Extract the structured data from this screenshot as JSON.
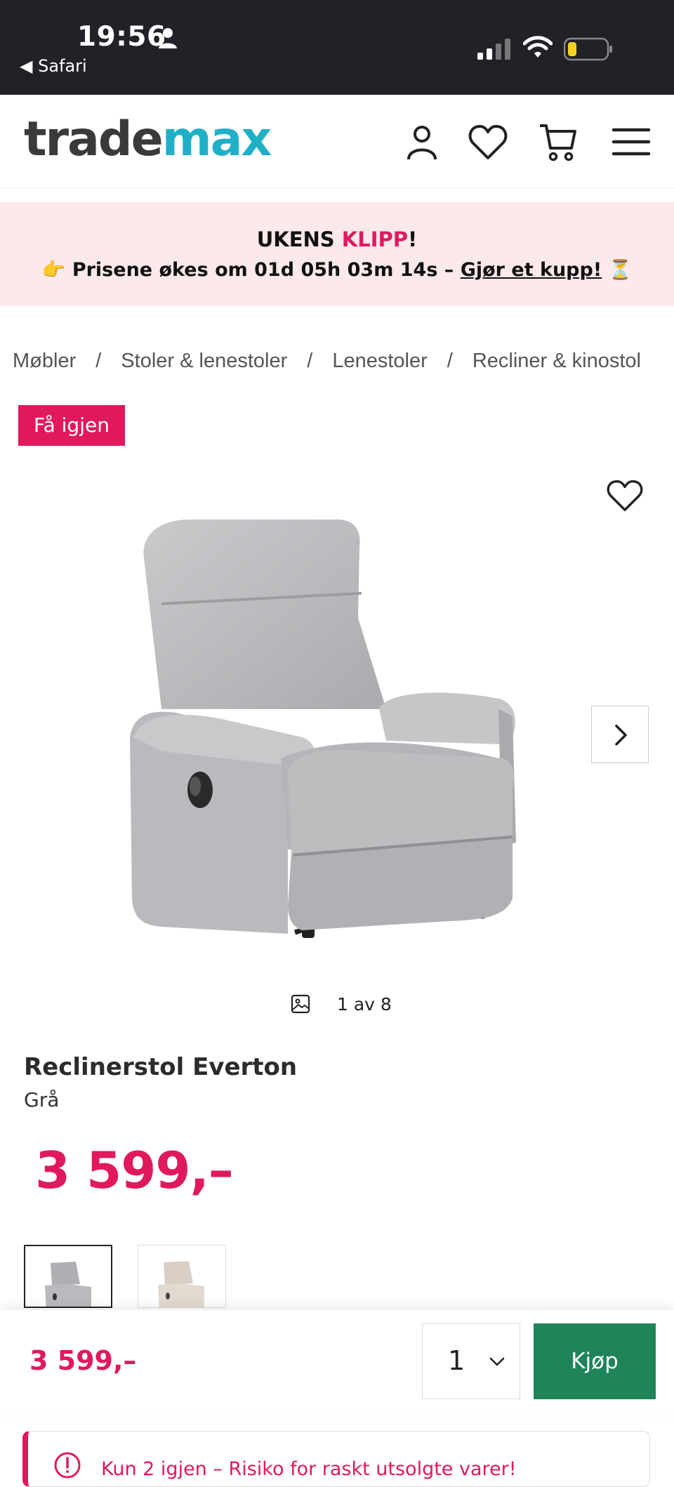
{
  "status_bar": {
    "time": "19:56",
    "back_app": "◀ Safari"
  },
  "header": {
    "logo_part1": "trade",
    "logo_part2": "max"
  },
  "promo": {
    "title_prefix": "UKENS ",
    "title_highlight": "KLIPP",
    "title_suffix": "!",
    "emoji_left": "👉",
    "countdown_text": "Prisene økes om 01d 05h 03m 14s – ",
    "link_text": "Gjør et kupp!",
    "emoji_right": "⏳"
  },
  "breadcrumb": [
    "Møbler",
    "Stoler & lenestoler",
    "Lenestoler",
    "Recliner & kinostol"
  ],
  "breadcrumb_sep": "/",
  "product": {
    "badge": "Få igjen",
    "image_counter": "1 av 8",
    "title": "Reclinerstol Everton",
    "variant": "Grå",
    "price": "3 599,–"
  },
  "colors": {
    "accent": "#e0195f",
    "buy": "#1f845a",
    "logo_teal": "#1fb0c8"
  },
  "buybar": {
    "price": "3 599,–",
    "quantity": "1",
    "buy_label": "Kjøp"
  },
  "notice": {
    "text": "Kun 2 igjen – Risiko for raskt utsolgte varer!"
  }
}
